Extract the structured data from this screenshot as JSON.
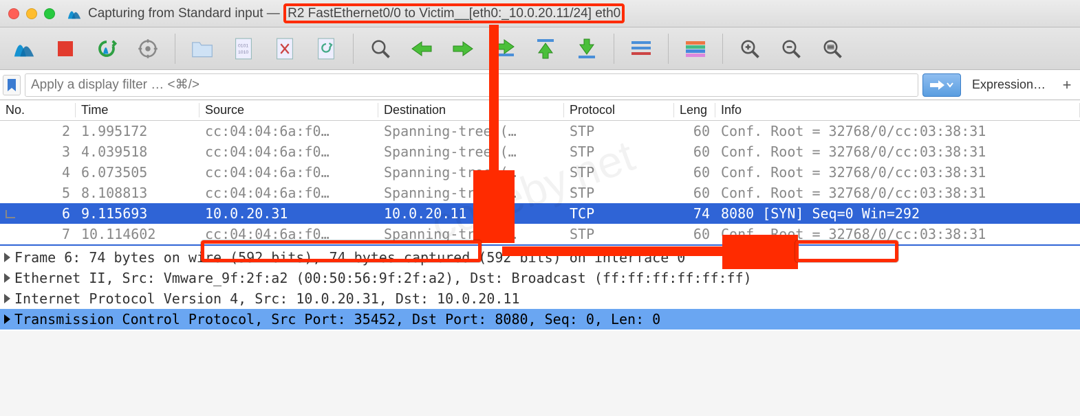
{
  "title": {
    "prefix": "Capturing from Standard input — ",
    "highlight": "R2 FastEthernet0/0 to Victim__[eth0:_10.0.20.11/24] eth0"
  },
  "filter": {
    "placeholder": "Apply a display filter … <⌘/>",
    "expression_label": "Expression…"
  },
  "columns": {
    "no": "No.",
    "time": "Time",
    "src": "Source",
    "dst": "Destination",
    "proto": "Protocol",
    "len": "Leng",
    "info": "Info"
  },
  "packets": [
    {
      "no": "2",
      "time": "1.995172",
      "src": "cc:04:04:6a:f0…",
      "dst": "Spanning-tree-(…",
      "proto": "STP",
      "len": "60",
      "info": "Conf. Root = 32768/0/cc:03:38:31"
    },
    {
      "no": "3",
      "time": "4.039518",
      "src": "cc:04:04:6a:f0…",
      "dst": "Spanning-tree-(…",
      "proto": "STP",
      "len": "60",
      "info": "Conf. Root = 32768/0/cc:03:38:31"
    },
    {
      "no": "4",
      "time": "6.073505",
      "src": "cc:04:04:6a:f0…",
      "dst": "Spanning-tree-(…",
      "proto": "STP",
      "len": "60",
      "info": "Conf. Root = 32768/0/cc:03:38:31"
    },
    {
      "no": "5",
      "time": "8.108813",
      "src": "cc:04:04:6a:f0…",
      "dst": "Spanning-tree-(…",
      "proto": "STP",
      "len": "60",
      "info": "Conf. Root = 32768/0/cc:03:38:31"
    },
    {
      "no": "6",
      "time": "9.115693",
      "src": "10.0.20.31",
      "dst": "10.0.20.11",
      "proto": "TCP",
      "len": "74",
      "info_hl": "8080 [SYN]",
      "info_rest": " Seq=0 Win=292",
      "selected": true
    },
    {
      "no": "7",
      "time": "10.114602",
      "src": "cc:04:04:6a:f0…",
      "dst": "Spanning-tree-(…",
      "proto": "STP",
      "len": "60",
      "info": "Conf. Root = 32768/0/cc:03:38:31"
    }
  ],
  "details": [
    "Frame 6: 74 bytes on wire (592 bits), 74 bytes captured (592 bits) on interface 0",
    "Ethernet II, Src: Vmware_9f:2f:a2 (00:50:56:9f:2f:a2), Dst: Broadcast (ff:ff:ff:ff:ff:ff)",
    "Internet Protocol Version 4, Src: 10.0.20.31, Dst: 10.0.20.11",
    "Transmission Control Protocol, Src Port: 35452, Dst Port: 8080, Seq: 0, Len: 0"
  ],
  "watermark": "codeby.net"
}
